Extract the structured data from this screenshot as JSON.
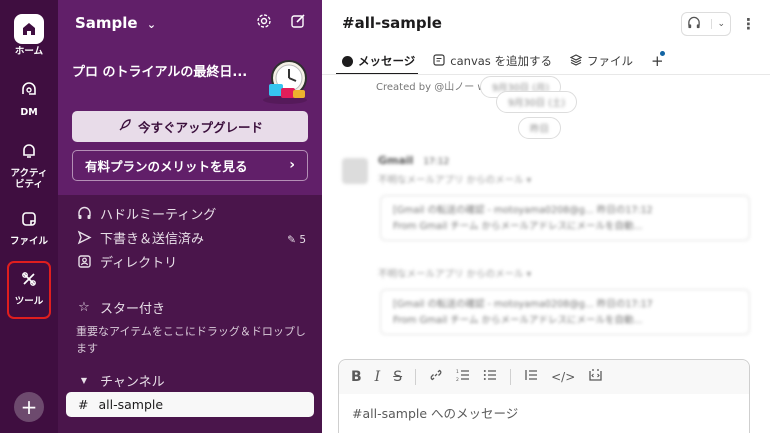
{
  "rail": {
    "items": [
      {
        "label": "ホーム",
        "icon": "home-icon"
      },
      {
        "label": "DM",
        "icon": "dm-icon"
      },
      {
        "label": "アクティビティ",
        "icon": "bell-icon"
      },
      {
        "label": "ファイル",
        "icon": "files-icon"
      },
      {
        "label": "ツール",
        "icon": "tools-icon"
      }
    ],
    "add_label": "+"
  },
  "sidebar": {
    "workspace": "Sample",
    "promo_title": "プロ のトライアルの最終日...",
    "upgrade_label": "今すぐアップグレード",
    "paid_label": "有料プランのメリットを見る",
    "nav": [
      {
        "label": "ハドルミーティング",
        "icon": "headphones-icon"
      },
      {
        "label": "下書き＆送信済み",
        "icon": "send-icon"
      },
      {
        "label": "ディレクトリ",
        "icon": "directory-icon"
      }
    ],
    "draft_count": "5",
    "starred_label": "スター付き",
    "starred_hint": "重要なアイテムをここにドラッグ＆ドロップします",
    "channels_label": "チャンネル",
    "channel": "all-sample"
  },
  "main": {
    "channel_title": "#all-sample",
    "tabs": [
      {
        "label": "メッセージ",
        "icon": "message-icon"
      },
      {
        "label": "canvas を追加する",
        "icon": "canvas-icon"
      },
      {
        "label": "ファイル",
        "icon": "files-icon"
      }
    ],
    "tab_add": "+",
    "created_text": "Created by @山ノー wi",
    "date_1": "9月30日 (月)",
    "date_2": "9月30日 (土)",
    "date_3": "昨日",
    "message": {
      "sender": "Gmail",
      "time": "17:12",
      "sub_1": "不明なメールアプリ からのメール ▾",
      "card_1_line_1": "[Gmail の転送の確認 - motoyama0208@g...   昨日の17:12",
      "card_1_line_2": "From Gmail チーム からメールアドレスにメールを自動...",
      "sub_2": "不明なメールアプリ からのメール ▾",
      "card_2_line_1": "[Gmail の転送の確認 - motoyama0208@g...   昨日の17:17",
      "card_2_line_2": "From Gmail チーム からメールアドレスにメールを自動..."
    },
    "composer_placeholder": "#all-sample へのメッセージ"
  },
  "colors": {
    "rail_bg": "#3f0e40",
    "sidebar_bg": "#4a154b",
    "sidebar_top_bg": "#611f69",
    "highlight": "#e01e1e"
  }
}
